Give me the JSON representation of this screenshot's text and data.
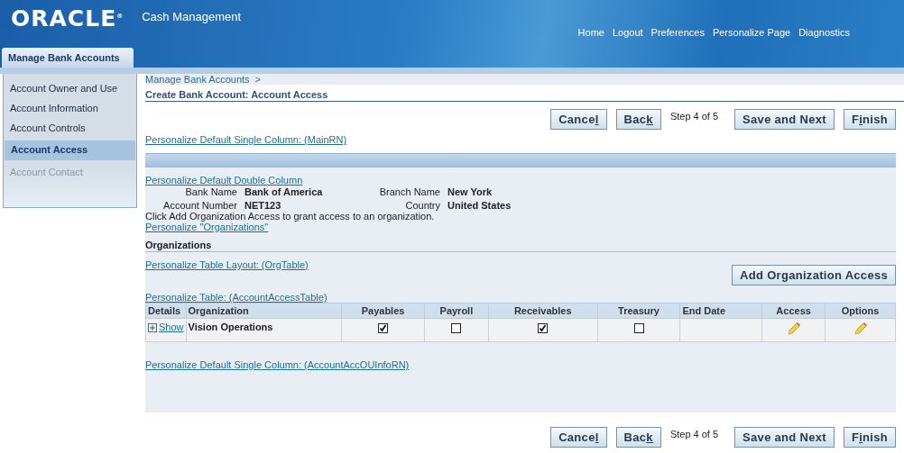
{
  "header": {
    "logo": "ORACLE$^{®}$",
    "app_title": "Cash Management",
    "links": [
      "Home",
      "Logout",
      "Preferences",
      "Personalize Page",
      "Diagnostics"
    ],
    "tab": {
      "label": "Manage Bank Accounts",
      "selected": true
    }
  },
  "sidebar": {
    "items": [
      {
        "label": "Account Owner and Use",
        "selected": false,
        "disabled": false
      },
      {
        "label": "Account Information",
        "selected": false,
        "disabled": false
      },
      {
        "label": "Account Controls",
        "selected": false,
        "disabled": false
      },
      {
        "label": "Account Access",
        "selected": true,
        "disabled": false
      },
      {
        "label": "Account Contact",
        "selected": false,
        "disabled": true
      }
    ]
  },
  "breadcrumb": {
    "link": "Manage Bank Accounts",
    "separator": ">"
  },
  "page_title": "Create Bank Account: Account Access",
  "top_actions": [
    {
      "kind": "button",
      "before": "Cance",
      "access_key": "l"
    },
    {
      "kind": "button",
      "before": "Bac",
      "access_key": "k"
    },
    {
      "kind": "text",
      "label": "Step 4 of 5"
    },
    {
      "kind": "button",
      "before": "Save and Next"
    },
    {
      "kind": "button",
      "before": "F",
      "access_key": "i",
      "after": "nish"
    }
  ],
  "personalize_main": "Personalize Default Single Column: (MainRN)",
  "personalize_double": "Personalize Default Double Column",
  "fields": [
    {
      "label": "Bank Name",
      "value": "Bank of America"
    },
    {
      "label": "Branch Name",
      "value": "New York"
    },
    {
      "label": "Account Number",
      "value": "NET123"
    },
    {
      "label": "Country",
      "value": "United States"
    }
  ],
  "instruction": "Click Add Organization Access to grant access to an organization.",
  "personalize_orgs": "Personalize \"Organizations\"",
  "section_title": "Organizations",
  "personalize_layout": "Personalize Table Layout: (OrgTable)",
  "add_button": "Add Organization Access",
  "personalize_table": "Personalize Table: (AccountAccessTable)",
  "table": {
    "columns": [
      "Details",
      "Organization",
      "Payables",
      "Payroll",
      "Receivables",
      "Treasury",
      "End Date",
      "Access",
      "Options"
    ],
    "rows": [
      {
        "cells": [
          {
            "kind": "details",
            "label": "Show"
          },
          {
            "kind": "text",
            "label": "Vision Operations"
          },
          {
            "kind": "checkbox",
            "checked": true
          },
          {
            "kind": "checkbox",
            "checked": false
          },
          {
            "kind": "checkbox",
            "checked": true
          },
          {
            "kind": "checkbox",
            "checked": false
          },
          {
            "kind": "empty"
          },
          {
            "kind": "edit"
          },
          {
            "kind": "edit"
          }
        ]
      }
    ]
  },
  "personalize_info": "Personalize Default Single Column: (AccountAccOUInfoRN)",
  "bottom_actions": [
    {
      "kind": "button",
      "before": "Cance",
      "access_key": "l"
    },
    {
      "kind": "button",
      "before": "Bac",
      "access_key": "k"
    },
    {
      "kind": "text",
      "label": "Step 4 of 5"
    },
    {
      "kind": "button",
      "before": "Save and Next"
    },
    {
      "kind": "button",
      "before": "F",
      "access_key": "i",
      "after": "nish"
    }
  ]
}
